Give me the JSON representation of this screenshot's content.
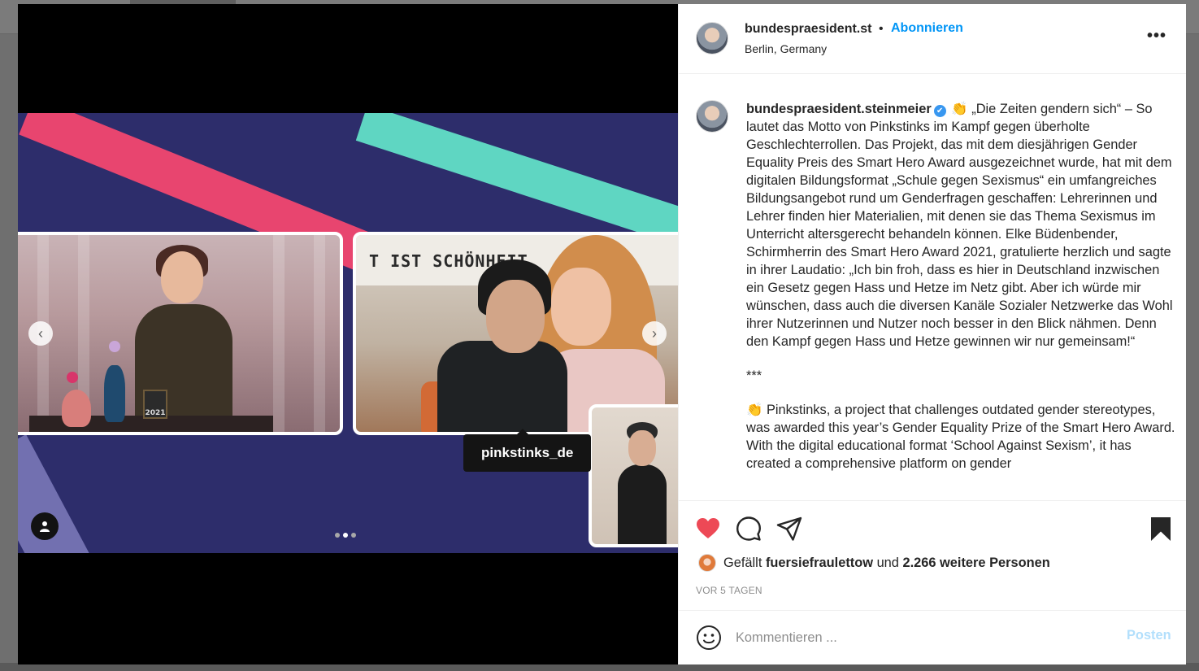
{
  "post": {
    "header": {
      "username": "bundespraesident.st",
      "separator": "•",
      "follow_label": "Abonnieren",
      "location": "Berlin, Germany",
      "more_label": "•••"
    },
    "media": {
      "banner_text": "T IST SCHÖNHEIT",
      "award_label": "2021",
      "tag_label": "pinkstinks_de",
      "prev_arrow": "‹",
      "next_arrow": "›",
      "carousel": {
        "count": 3,
        "active_index": 1
      }
    },
    "caption": {
      "username": "bundespraesident.steinmeier",
      "verified_mark": "✔",
      "paragraph_de": "👏 „Die Zeiten gendern sich“ – So lautet das Motto von Pinkstinks im Kampf gegen überholte Geschlechterrollen. Das Projekt, das mit dem diesjährigen Gender Equality Preis des Smart Hero Award ausgezeichnet wurde, hat mit dem digitalen Bildungsformat „Schule gegen Sexismus“ ein umfangreiches Bildungsangebot rund um Genderfragen geschaffen: Lehrerinnen und Lehrer finden hier Materialien, mit denen sie das Thema Sexismus im Unterricht altersgerecht behandeln können. Elke Büdenbender, Schirmherrin des Smart Hero Award 2021, gratulierte herzlich und sagte in ihrer Laudatio: „Ich bin froh, dass es hier in Deutschland inzwischen ein Gesetz gegen Hass und Hetze im Netz gibt. Aber ich würde mir wünschen, dass auch die diversen Kanäle Sozialer Netzwerke das Wohl ihrer Nutzerinnen und Nutzer noch besser in den Blick nähmen. Denn den Kampf gegen Hass und Hetze gewinnen wir nur gemeinsam!“",
      "divider": "***",
      "paragraph_en": "👏 Pinkstinks, a project that challenges outdated gender stereotypes, was awarded this year’s Gender Equality Prize of the Smart Hero Award. With the digital educational format ‘School Against Sexism’, it has created a comprehensive platform on gender"
    },
    "likes": {
      "prefix": "Gefällt",
      "first_user": "fuersiefraulettow",
      "connector": "und",
      "others": "2.266 weitere Personen"
    },
    "timestamp": "VOR 5 TAGEN",
    "comment_box": {
      "placeholder": "Kommentieren ...",
      "value": "",
      "post_label": "Posten"
    },
    "icons": {
      "like": "heart-icon",
      "comment": "comment-icon",
      "share": "paper-plane-icon",
      "save": "bookmark-icon",
      "emoji": "smiley-icon",
      "tag": "user-icon"
    },
    "colors": {
      "accent": "#0095f6",
      "like_active": "#ed4956",
      "post_disabled": "#b2dffc"
    }
  }
}
